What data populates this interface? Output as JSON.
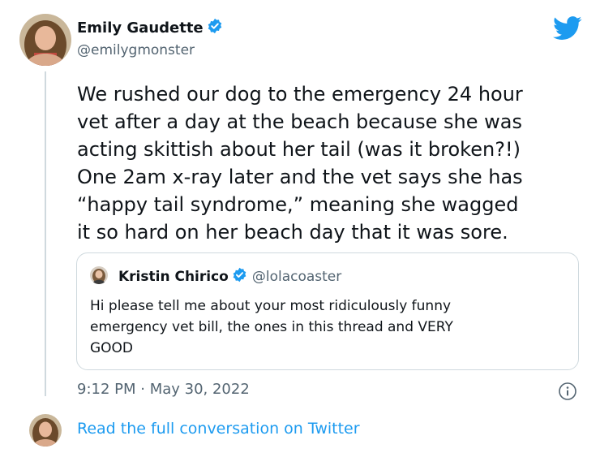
{
  "author": {
    "name": "Emily Gaudette",
    "handle": "@emilygmonster",
    "avatar_icon": "profile-photo-woman",
    "verified": true
  },
  "tweet": {
    "text": "We rushed our dog to the emergency 24 hour\nvet after a day at the beach because she was\nacting skittish about her tail (was it broken?!)\nOne 2am x-ray later and the vet says she has\n“happy tail syndrome,” meaning she wagged\nit so hard on her beach day that it was sore.",
    "timestamp": "9:12 PM · May 30, 2022"
  },
  "quoted_tweet": {
    "name": "Kristin Chirico",
    "handle": "@lolacoaster",
    "avatar_icon": "profile-photo-small",
    "verified": true,
    "text": "Hi please tell me about your most ridiculously funny\nemergency vet bill, the ones in this thread and VERY\nGOOD"
  },
  "footer": {
    "link_text": "Read the full conversation on Twitter"
  },
  "icons": {
    "brand": "twitter-bird-icon",
    "info": "info-icon",
    "verified": "verified-badge-icon"
  },
  "colors": {
    "brand_blue": "#1d9bf0",
    "text": "#0f1419",
    "muted": "#536471",
    "border": "#cfd9de"
  }
}
